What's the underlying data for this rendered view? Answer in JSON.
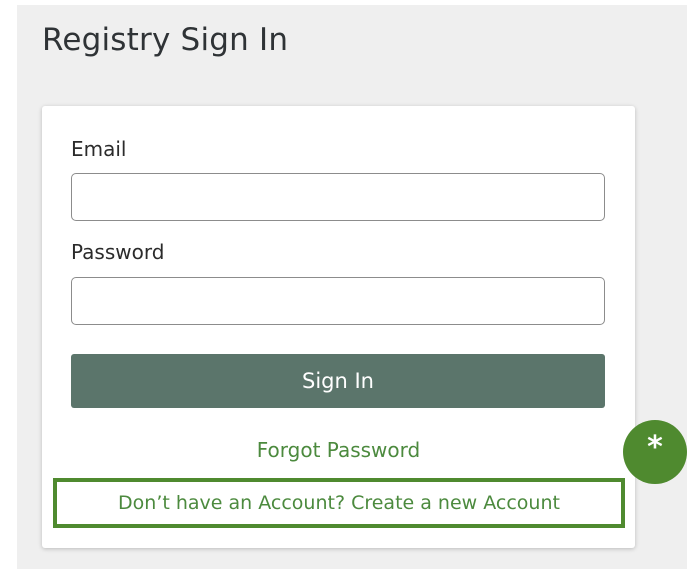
{
  "page": {
    "title": "Registry Sign In"
  },
  "form": {
    "email_label": "Email",
    "email_value": "",
    "password_label": "Password",
    "password_value": "",
    "signin_label": "Sign In",
    "forgot_label": "Forgot Password",
    "create_account_label": "Don’t have an Account? Create a new Account"
  },
  "annotation": {
    "marker_text": "*"
  },
  "colors": {
    "panel_background": "#efefef",
    "button_background": "#5b756b",
    "link_color": "#4c8a3e",
    "highlight_green": "#4f8a2f"
  }
}
